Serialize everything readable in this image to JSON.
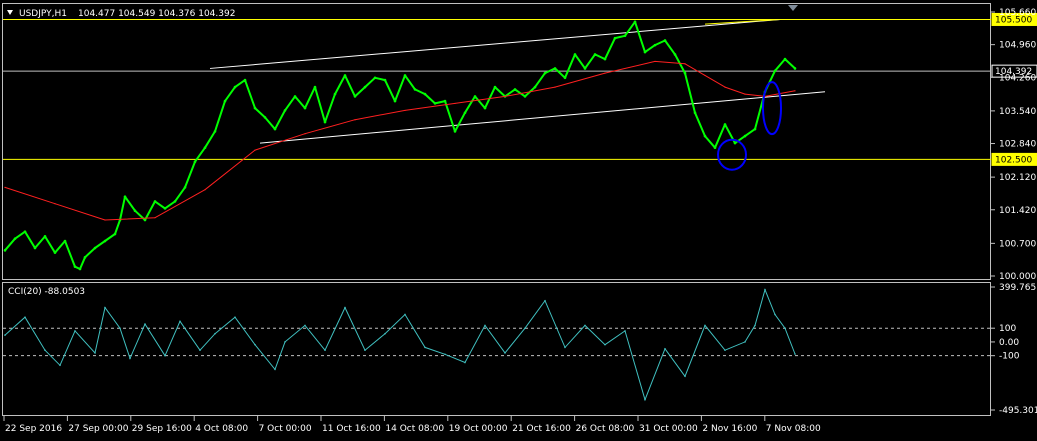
{
  "chart_data": [
    {
      "type": "line",
      "panel": "price",
      "header": {
        "symbol": "USDJPY,H1",
        "ohlc": "104.477 104.549 104.376 104.392"
      },
      "y_ticks": [
        "105.660",
        "104.960",
        "104.260",
        "103.540",
        "102.840",
        "102.120",
        "101.420",
        "100.700",
        "100.000"
      ],
      "y_tick_values": [
        105.66,
        104.96,
        104.26,
        103.54,
        102.84,
        102.12,
        101.42,
        100.7,
        100.0
      ],
      "ylim": [
        100.0,
        105.66
      ],
      "x_ticks": [
        "22 Sep 2016",
        "27 Sep 00:00",
        "29 Sep 16:00",
        "4 Oct 08:00",
        "7 Oct 00:00",
        "11 Oct 16:00",
        "14 Oct 08:00",
        "19 Oct 00:00",
        "21 Oct 16:00",
        "26 Oct 08:00",
        "31 Oct 00:00",
        "2 Nov 16:00",
        "7 Nov 08:00"
      ],
      "horizontal_levels": [
        {
          "label": "105.500",
          "value": 105.5,
          "color": "#ffff00",
          "highlight": true
        },
        {
          "label": "104.392",
          "value": 104.392,
          "color": "#c0c0c0",
          "highlight": false
        },
        {
          "label": "102.500",
          "value": 102.5,
          "color": "#ffff00",
          "highlight": true
        }
      ],
      "series": [
        {
          "color": "#00ff00",
          "x_index": [
            0,
            10,
            20,
            30,
            40,
            50,
            60,
            70,
            75,
            80,
            90,
            100,
            110,
            115,
            120,
            130,
            140,
            150,
            160,
            170,
            180,
            190,
            200,
            210,
            220,
            230,
            240,
            250,
            260,
            270,
            280,
            290,
            300,
            310,
            320,
            330,
            340,
            350,
            360,
            370,
            380,
            390,
            400,
            410,
            420,
            430,
            440,
            450,
            460,
            470,
            480,
            490,
            500,
            510,
            520,
            530,
            540,
            550,
            560,
            570,
            580,
            590,
            600,
            610,
            620,
            630,
            640,
            650,
            660,
            670,
            680,
            690,
            700,
            710,
            720,
            730,
            740,
            750,
            760,
            770,
            780,
            790
          ],
          "values": [
            100.55,
            100.8,
            100.95,
            100.6,
            100.85,
            100.5,
            100.75,
            100.2,
            100.15,
            100.4,
            100.6,
            100.75,
            100.9,
            101.2,
            101.7,
            101.4,
            101.2,
            101.6,
            101.45,
            101.6,
            101.9,
            102.45,
            102.75,
            103.1,
            103.75,
            104.05,
            104.2,
            103.6,
            103.4,
            103.15,
            103.55,
            103.85,
            103.6,
            104.05,
            103.3,
            103.9,
            104.3,
            103.85,
            104.05,
            104.25,
            104.2,
            103.75,
            104.3,
            104.0,
            103.9,
            103.7,
            103.75,
            103.1,
            103.5,
            103.85,
            103.6,
            104.05,
            103.85,
            104.0,
            103.85,
            104.05,
            104.35,
            104.45,
            104.25,
            104.75,
            104.45,
            104.75,
            104.65,
            105.1,
            105.15,
            105.45,
            104.8,
            104.95,
            105.05,
            104.75,
            104.35,
            103.5,
            103.0,
            102.75,
            103.25,
            102.85,
            103.0,
            103.15,
            103.95,
            104.4,
            104.65,
            104.45
          ]
        },
        {
          "color": "#ff2020",
          "x_index": [
            0,
            50,
            100,
            150,
            200,
            250,
            300,
            350,
            400,
            450,
            500,
            550,
            600,
            650,
            680,
            700,
            720,
            740,
            760,
            790
          ],
          "values": [
            101.9,
            101.55,
            101.2,
            101.25,
            101.85,
            102.7,
            103.05,
            103.35,
            103.55,
            103.7,
            103.85,
            104.05,
            104.35,
            104.6,
            104.55,
            104.3,
            104.05,
            103.9,
            103.85,
            103.97
          ]
        }
      ],
      "trendlines": [
        {
          "color": "#ffffff",
          "x_index": [
            205,
            775
          ],
          "values": [
            104.45,
            105.5
          ]
        },
        {
          "color": "#ffffff",
          "x_index": [
            255,
            820
          ],
          "values": [
            102.85,
            103.95
          ]
        },
        {
          "color": "#ffff00",
          "x_index": [
            700,
            775
          ],
          "values": [
            105.4,
            105.5
          ]
        }
      ],
      "annotations": [
        {
          "shape": "ellipse",
          "color": "#0000ff",
          "x_index": 727,
          "value": 102.6
        },
        {
          "shape": "ellipse",
          "color": "#0000ff",
          "x_index": 767,
          "value": 103.6
        }
      ]
    },
    {
      "type": "line",
      "panel": "indicator",
      "header": "CCI(20) -88.0503",
      "y_ticks": [
        "399.7651",
        "100",
        "0.00",
        "-100",
        "-495.3011"
      ],
      "y_tick_values": [
        399.7651,
        100,
        0,
        -100,
        -495.3011
      ],
      "ylim": [
        -495.3011,
        399.7651
      ],
      "dashed_levels": [
        100,
        -100
      ],
      "series": [
        {
          "color": "#40c0c0",
          "x_index": [
            0,
            20,
            40,
            55,
            70,
            90,
            100,
            115,
            125,
            140,
            160,
            175,
            195,
            210,
            230,
            250,
            270,
            280,
            300,
            320,
            340,
            360,
            380,
            400,
            420,
            440,
            460,
            480,
            500,
            520,
            540,
            560,
            580,
            600,
            620,
            640,
            660,
            680,
            700,
            720,
            740,
            750,
            760,
            770,
            780,
            790
          ],
          "values": [
            50,
            180,
            -60,
            -170,
            80,
            -80,
            250,
            100,
            -120,
            130,
            -100,
            150,
            -60,
            60,
            180,
            -20,
            -200,
            0,
            120,
            -60,
            250,
            -60,
            60,
            200,
            -40,
            -90,
            -150,
            120,
            -80,
            100,
            300,
            -40,
            120,
            -20,
            80,
            -420,
            -50,
            -250,
            120,
            -60,
            0,
            120,
            380,
            200,
            100,
            -88.05
          ]
        }
      ]
    }
  ]
}
